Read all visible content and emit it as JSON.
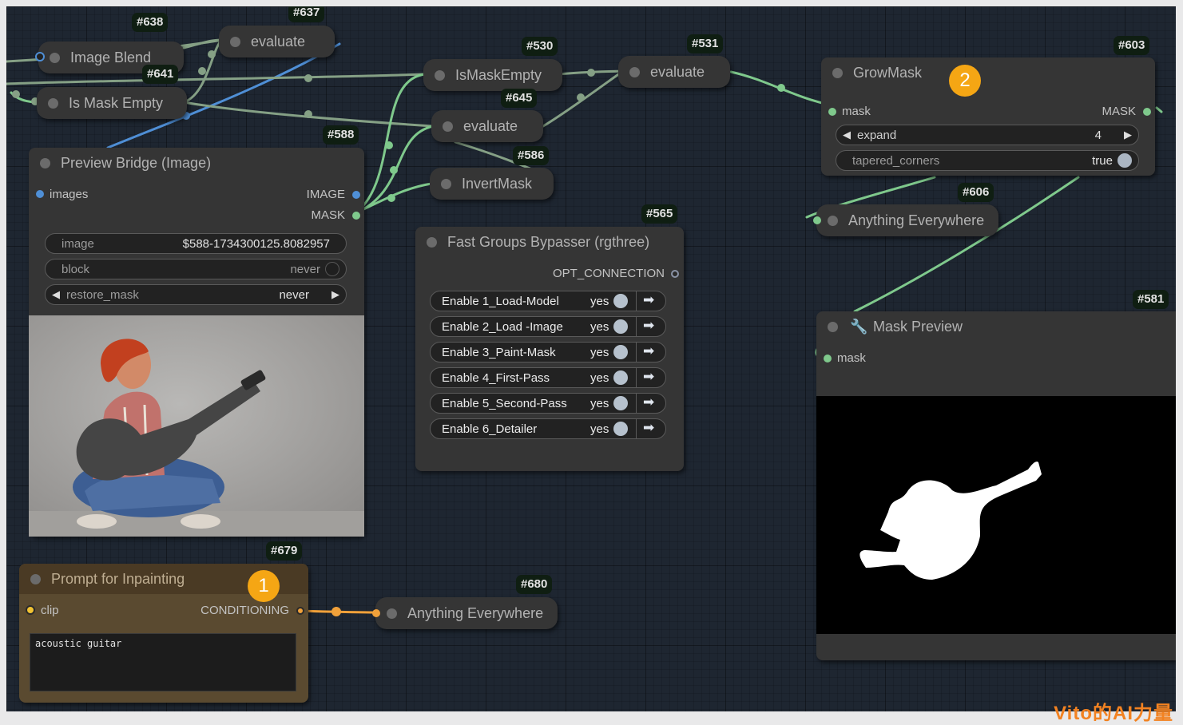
{
  "colors": {
    "canvas": "#1e2631",
    "node_body": "#353535",
    "prompt_node_body": "#5a4a30",
    "mask_wire": "#7fc98c",
    "image_wire": "#4f8fd6",
    "conditioning_wire": "#f1a13a",
    "badge_orange": "#f5a614"
  },
  "nodes": {
    "image_blend": {
      "id": "#638",
      "title": "Image Blend"
    },
    "evaluate_637": {
      "id": "#637",
      "title": "evaluate"
    },
    "is_mask_empty_641": {
      "id": "#641",
      "title": "Is Mask Empty"
    },
    "is_mask_empty_530": {
      "id": "#530",
      "title": "IsMaskEmpty"
    },
    "evaluate_531": {
      "id": "#531",
      "title": "evaluate"
    },
    "evaluate_645": {
      "id": "#645",
      "title": "evaluate"
    },
    "invert_mask": {
      "id": "#586",
      "title": "InvertMask"
    },
    "grow_mask": {
      "id": "#603",
      "title": "GrowMask",
      "marker": "2",
      "input": "mask",
      "output": "MASK",
      "expand_label": "expand",
      "expand_value": "4",
      "tapered_label": "tapered_corners",
      "tapered_value": "true"
    },
    "anything_everywhere_606": {
      "id": "#606",
      "title": "Anything Everywhere"
    },
    "preview_bridge": {
      "id": "#588",
      "title": "Preview Bridge (Image)",
      "input": "images",
      "output_image": "IMAGE",
      "output_mask": "MASK",
      "image_label": "image",
      "image_value": "$588-1734300125.8082957",
      "block_label": "block",
      "block_value": "never",
      "restore_label": "restore_mask",
      "restore_value": "never"
    },
    "fast_groups_bypasser": {
      "id": "#565",
      "title": "Fast Groups Bypasser (rgthree)",
      "output": "OPT_CONNECTION",
      "groups": [
        {
          "label": "Enable 1_Load-Model",
          "value": "yes"
        },
        {
          "label": "Enable 2_Load -Image",
          "value": "yes"
        },
        {
          "label": "Enable 3_Paint-Mask",
          "value": "yes"
        },
        {
          "label": "Enable 4_First-Pass",
          "value": "yes"
        },
        {
          "label": "Enable 5_Second-Pass",
          "value": "yes"
        },
        {
          "label": "Enable 6_Detailer",
          "value": "yes"
        }
      ]
    },
    "mask_preview": {
      "id": "#581",
      "title": "Mask Preview",
      "input": "mask"
    },
    "prompt_inpainting": {
      "id": "#679",
      "title": "Prompt for Inpainting",
      "marker": "1",
      "input": "clip",
      "output": "CONDITIONING",
      "text": "acoustic guitar"
    },
    "anything_everywhere_680": {
      "id": "#680",
      "title": "Anything Everywhere"
    }
  },
  "watermark": "Vito的AI力量"
}
